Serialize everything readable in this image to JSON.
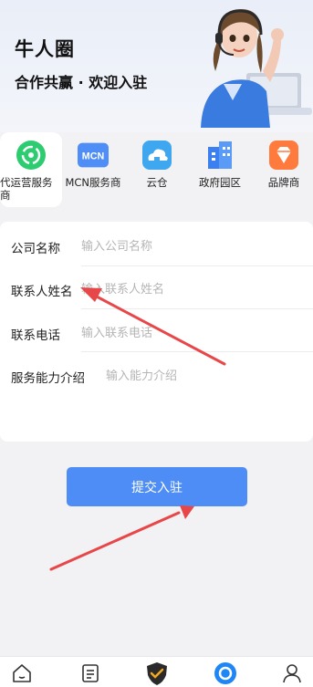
{
  "banner": {
    "title": "牛人圈",
    "subtitle": "合作共赢 · 欢迎入驻"
  },
  "categories": [
    {
      "label": "代运营服务商",
      "icon": "operator-service-icon",
      "color": "#2ecc71",
      "active": true
    },
    {
      "label": "MCN服务商",
      "icon": "mcn-logo-icon",
      "icon_text": "MCN",
      "color": "#4f8ef7",
      "active": false
    },
    {
      "label": "云仓",
      "icon": "cloud-warehouse-icon",
      "color": "#3fa7f0",
      "active": false
    },
    {
      "label": "政府园区",
      "icon": "government-park-icon",
      "color": "#3b7ff0",
      "active": false
    },
    {
      "label": "品牌商",
      "icon": "brand-diamond-icon",
      "color": "#ff7a3d",
      "active": false
    }
  ],
  "form": {
    "company_name": {
      "label": "公司名称",
      "placeholder": "输入公司名称"
    },
    "contact_name": {
      "label": "联系人姓名",
      "placeholder": "输入联系人姓名"
    },
    "contact_phone": {
      "label": "联系电话",
      "placeholder": "输入联系电话"
    },
    "service_intro": {
      "label": "服务能力介绍",
      "placeholder": "输入能力介绍"
    }
  },
  "submit_label": "提交入驻",
  "annotation_color": "#e8474a",
  "tabbar": [
    {
      "icon": "home-icon"
    },
    {
      "icon": "document-icon"
    },
    {
      "icon": "shield-check-icon"
    },
    {
      "icon": "circle-active-icon",
      "color": "#1e86f5"
    },
    {
      "icon": "profile-icon"
    }
  ]
}
